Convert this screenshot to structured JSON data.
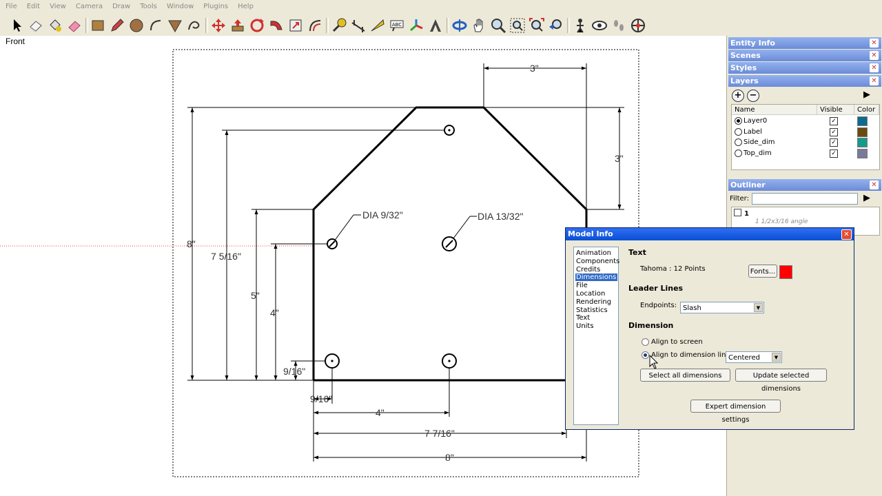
{
  "menu": [
    "File",
    "Edit",
    "View",
    "Camera",
    "Draw",
    "Tools",
    "Window",
    "Plugins",
    "Help"
  ],
  "toolbar_icons": [
    "select-icon",
    "eraser-icon",
    "paint-bucket-icon",
    "eraser-pink-icon",
    "rectangle-icon",
    "pencil-icon",
    "circle-icon",
    "arc-icon",
    "polygon-icon",
    "freehand-icon",
    "move-icon",
    "push-pull-icon",
    "rotate-icon",
    "follow-me-icon",
    "scale-icon",
    "offset-icon",
    "tape-measure-icon",
    "dimension-icon",
    "protractor-icon",
    "text-icon",
    "axes-icon",
    "3d-text-icon",
    "orbit-icon",
    "pan-icon",
    "zoom-icon",
    "zoom-window-icon",
    "zoom-extents-icon",
    "previous-view-icon",
    "position-camera-icon",
    "look-around-icon",
    "walk-icon",
    "section-plane-icon"
  ],
  "viewport": {
    "view_label": "Front"
  },
  "drawing": {
    "dim_3_top": "3\"",
    "dim_3_right": "3\"",
    "dim_8_left": "8\"",
    "dim_7_5_16": "7 5/16\"",
    "dim_5": "5\"",
    "dim_4_vert": "4\"",
    "dim_9_16_vert": "9/16\"",
    "dim_9_16_horiz": "9/16\"",
    "dim_4_horiz": "4\"",
    "dim_7_7_16": "7 7/16\"",
    "dim_8_bottom": "8\"",
    "dia_small": "DIA 9/32\"",
    "dia_large": "DIA 13/32\""
  },
  "tray": {
    "panels": [
      "Entity Info",
      "Scenes",
      "Styles",
      "Layers"
    ],
    "layers": {
      "columns": {
        "name": "Name",
        "visible": "Visible",
        "color": "Color"
      },
      "rows": [
        {
          "name": "Layer0",
          "active": true,
          "visible": true,
          "color": "#0d6b8e"
        },
        {
          "name": "Label",
          "active": false,
          "visible": true,
          "color": "#6b4a0f"
        },
        {
          "name": "Side_dim",
          "active": false,
          "visible": true,
          "color": "#149c8a"
        },
        {
          "name": "Top_dim",
          "active": false,
          "visible": true,
          "color": "#7a7a9a"
        }
      ]
    },
    "outliner": {
      "title": "Outliner",
      "filter_label": "Filter:",
      "filter_value": "",
      "root": "1",
      "child": "1 1/2x3/16 angle"
    }
  },
  "dialog": {
    "title": "Model Info",
    "categories": [
      "Animation",
      "Components",
      "Credits",
      "Dimensions",
      "File",
      "Location",
      "Rendering",
      "Statistics",
      "Text",
      "Units"
    ],
    "selected_category": "Dimensions",
    "text_section": "Text",
    "font_desc": "Tahoma : 12 Points",
    "fonts_button": "Fonts...",
    "font_color": "#ff0000",
    "leader_section": "Leader Lines",
    "endpoints_label": "Endpoints:",
    "endpoints_value": "Slash",
    "dimension_section": "Dimension",
    "align_screen": "Align to screen",
    "align_dimline": "Align to dimension line",
    "align_selected": "dimension-line",
    "position_value": "Centered",
    "select_all_button": "Select all dimensions",
    "update_button": "Update selected dimensions",
    "expert_button": "Expert dimension settings"
  }
}
